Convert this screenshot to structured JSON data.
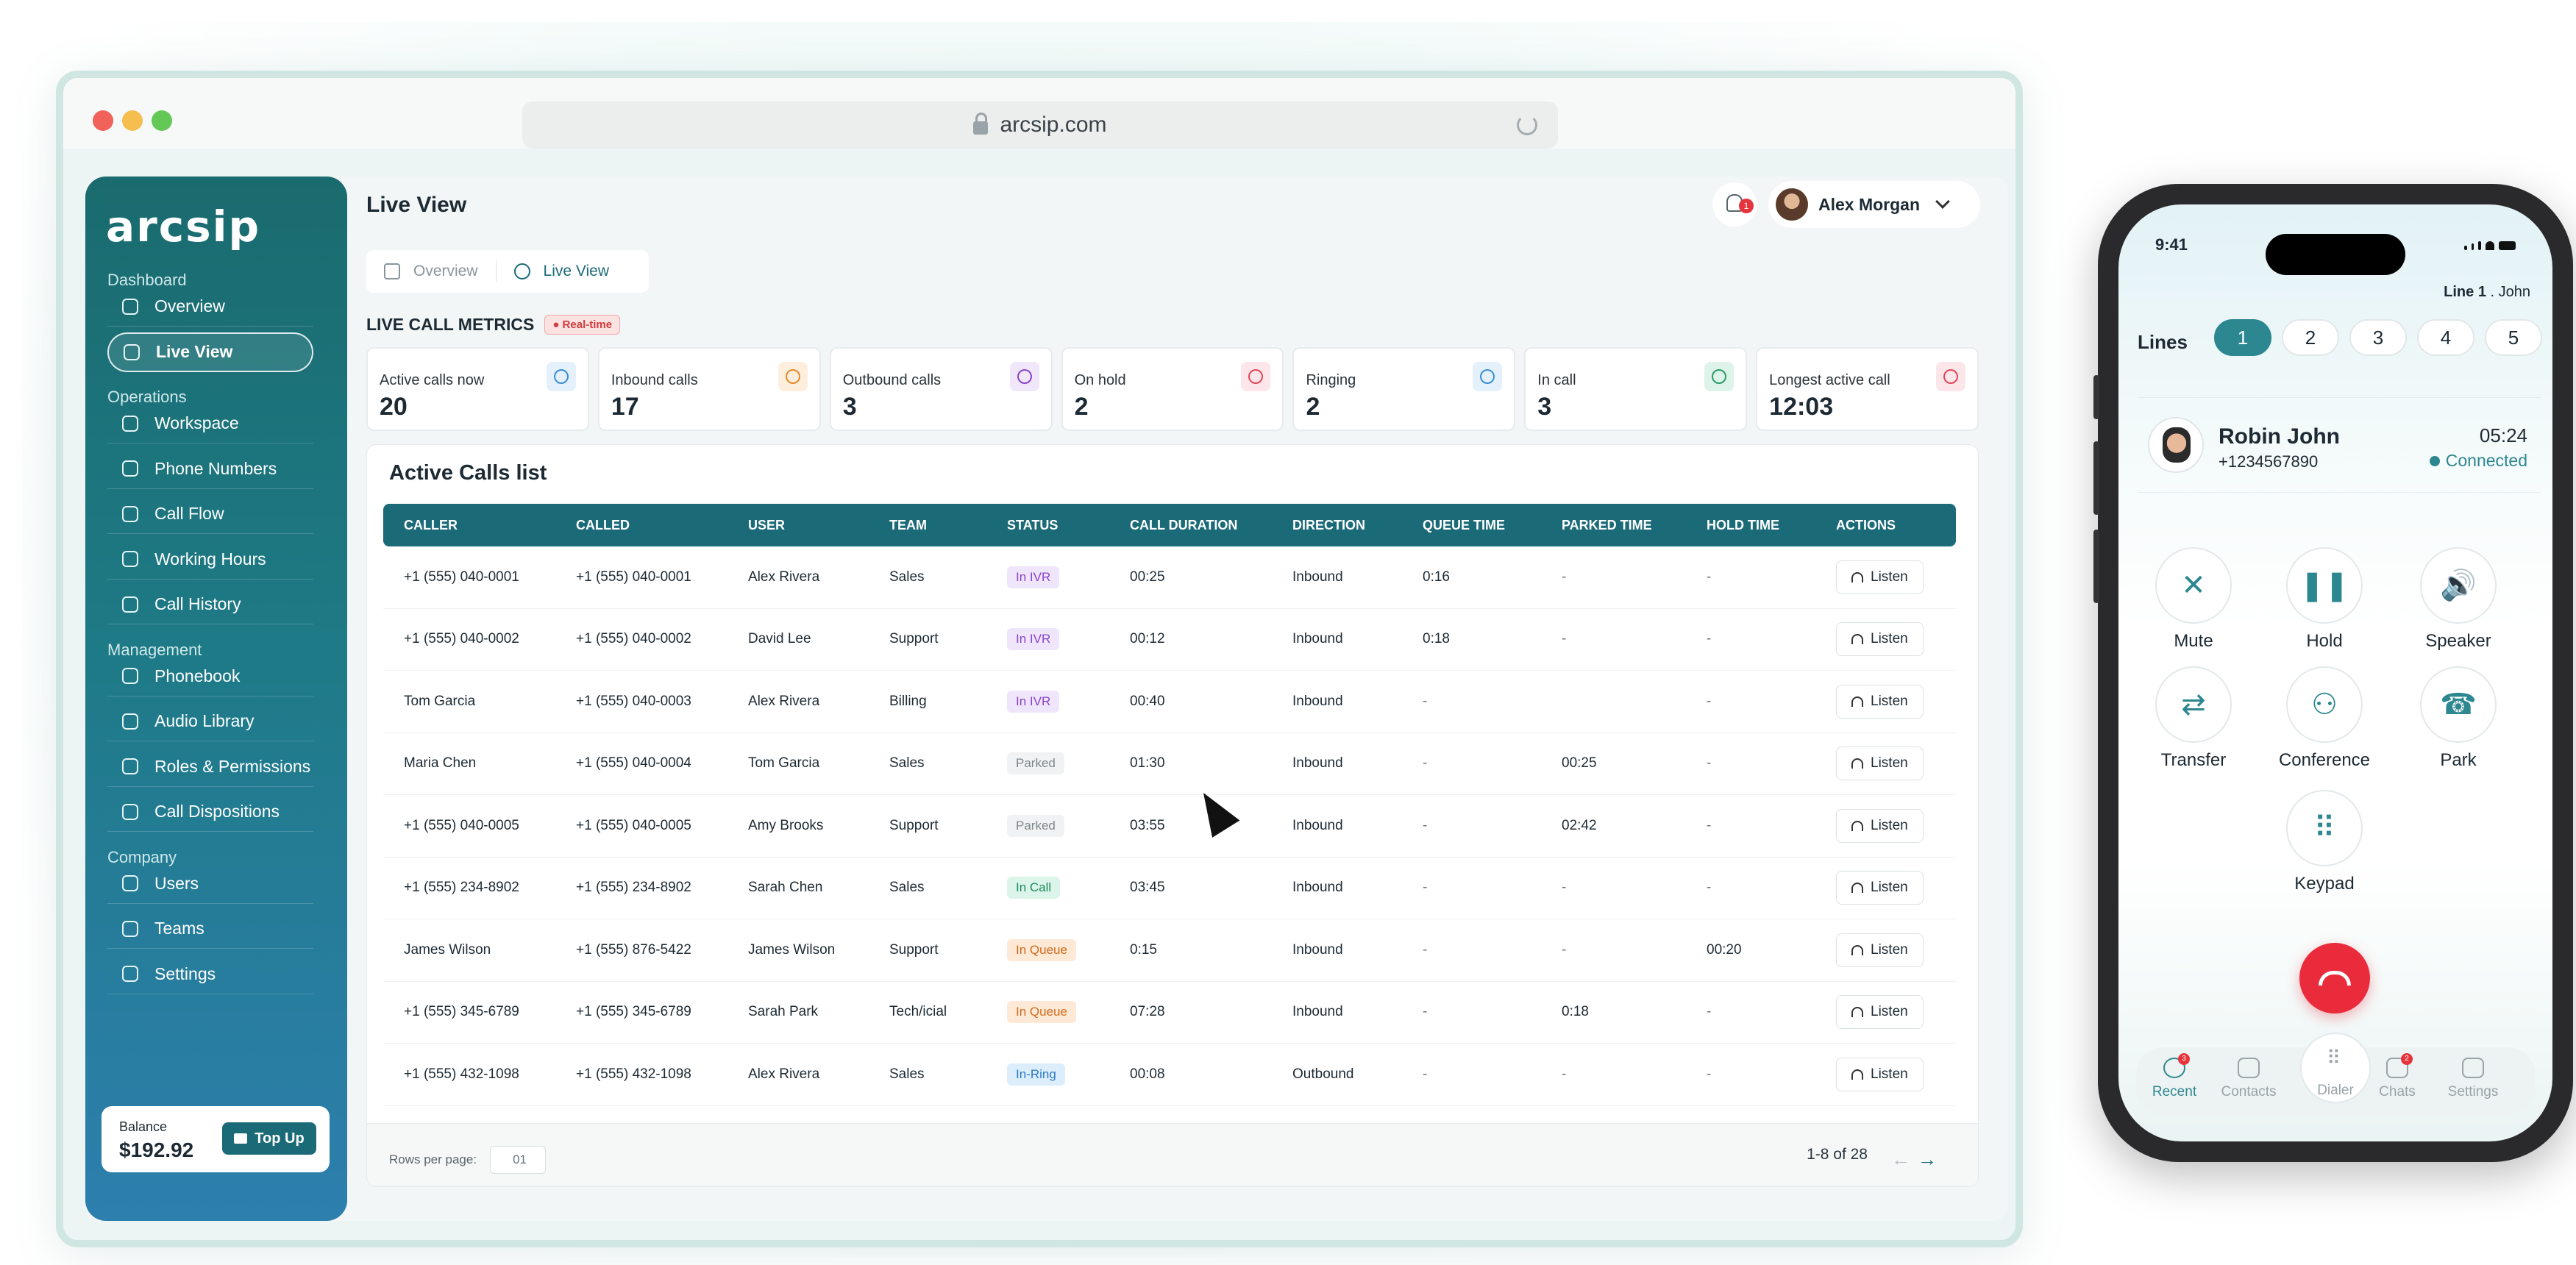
{
  "browser": {
    "url": "arcsip.com"
  },
  "brand": {
    "logo": "arcsip"
  },
  "sidebar": {
    "sections": [
      {
        "title": "Dashboard",
        "items": [
          {
            "label": "Overview",
            "icon": "overview-icon"
          },
          {
            "label": "Live View",
            "icon": "live-view-icon",
            "active": true
          }
        ]
      },
      {
        "title": "Operations",
        "items": [
          {
            "label": "Workspace",
            "icon": "workspace-icon"
          },
          {
            "label": "Phone Numbers",
            "icon": "grid-icon"
          },
          {
            "label": "Call Flow",
            "icon": "flow-icon"
          },
          {
            "label": "Working Hours",
            "icon": "clock-icon"
          },
          {
            "label": "Call History",
            "icon": "history-icon"
          }
        ]
      },
      {
        "title": "Management",
        "items": [
          {
            "label": "Phonebook",
            "icon": "phonebook-icon"
          },
          {
            "label": "Audio Library",
            "icon": "mic-icon"
          },
          {
            "label": "Roles & Permissions",
            "icon": "roles-icon"
          },
          {
            "label": "Call Dispositions",
            "icon": "phone-icon"
          }
        ]
      },
      {
        "title": "Company",
        "items": [
          {
            "label": "Users",
            "icon": "users-icon"
          },
          {
            "label": "Teams",
            "icon": "teams-icon"
          },
          {
            "label": "Settings",
            "icon": "gear-icon"
          }
        ]
      }
    ],
    "balance": {
      "label": "Balance",
      "amount": "$192.92",
      "button": "Top Up"
    }
  },
  "header": {
    "title": "Live View",
    "notifications": "1",
    "user": "Alex Morgan"
  },
  "tabs": [
    {
      "label": "Overview",
      "active": false
    },
    {
      "label": "Live View",
      "active": true
    }
  ],
  "metrics": {
    "title": "LIVE CALL METRICS",
    "badge": "Real-time",
    "cards": [
      {
        "label": "Active calls now",
        "value": "20",
        "color": "#3a8fd8",
        "bg": "#e4f0fb"
      },
      {
        "label": "Inbound calls",
        "value": "17",
        "color": "#e88a2c",
        "bg": "#fdeedd"
      },
      {
        "label": "Outbound calls",
        "value": "3",
        "color": "#8a44c9",
        "bg": "#f0e7fb"
      },
      {
        "label": "On hold",
        "value": "2",
        "color": "#e0485a",
        "bg": "#fce6e9"
      },
      {
        "label": "Ringing",
        "value": "2",
        "color": "#3a8fd8",
        "bg": "#e4f0fb"
      },
      {
        "label": "In call",
        "value": "3",
        "color": "#2a9a6b",
        "bg": "#def4ea"
      },
      {
        "label": "Longest active call",
        "value": "12:03",
        "color": "#e0485a",
        "bg": "#fce6e9"
      }
    ]
  },
  "calls": {
    "title": "Active Calls list",
    "columns": [
      "CALLER",
      "CALLED",
      "USER",
      "TEAM",
      "STATUS",
      "CALL DURATION",
      "DIRECTION",
      "QUEUE TIME",
      "PARKED TIME",
      "HOLD TIME",
      "ACTIONS"
    ],
    "action_label": "Listen",
    "rows": [
      {
        "caller": "+1 (555) 040-0001",
        "called": "+1 (555) 040-0001",
        "user": "Alex Rivera",
        "team": "Sales",
        "status": "In IVR",
        "status_type": "ivr",
        "duration": "00:25",
        "direction": "Inbound",
        "queue": "0:16",
        "parked": "-",
        "hold": "-"
      },
      {
        "caller": "+1 (555) 040-0002",
        "called": "+1 (555) 040-0002",
        "user": "David Lee",
        "team": "Support",
        "status": "In IVR",
        "status_type": "ivr",
        "duration": "00:12",
        "direction": "Inbound",
        "queue": "0:18",
        "parked": "-",
        "hold": "-"
      },
      {
        "caller": "Tom Garcia",
        "called": "+1 (555) 040-0003",
        "user": "Alex Rivera",
        "team": "Billing",
        "status": "In IVR",
        "status_type": "ivr",
        "duration": "00:40",
        "direction": "Inbound",
        "queue": "-",
        "parked": "",
        "hold": "-"
      },
      {
        "caller": "Maria Chen",
        "called": "+1 (555) 040-0004",
        "user": "Tom Garcia",
        "team": "Sales",
        "status": "Parked",
        "status_type": "parked",
        "duration": "01:30",
        "direction": "Inbound",
        "queue": "-",
        "parked": "00:25",
        "hold": "-"
      },
      {
        "caller": "+1 (555) 040-0005",
        "called": "+1 (555) 040-0005",
        "user": "Amy Brooks",
        "team": "Support",
        "status": "Parked",
        "status_type": "parked",
        "duration": "03:55",
        "direction": "Inbound",
        "queue": "-",
        "parked": "02:42",
        "hold": "-"
      },
      {
        "caller": "+1 (555) 234-8902",
        "called": "+1 (555) 234-8902",
        "user": "Sarah Chen",
        "team": "Sales",
        "status": "In Call",
        "status_type": "incall",
        "duration": "03:45",
        "direction": "Inbound",
        "queue": "-",
        "parked": "-",
        "hold": "-"
      },
      {
        "caller": "James Wilson",
        "called": "+1 (555) 876-5422",
        "user": "James Wilson",
        "team": "Support",
        "status": "In Queue",
        "status_type": "queue",
        "duration": "0:15",
        "direction": "Inbound",
        "queue": "-",
        "parked": "-",
        "hold": "00:20"
      },
      {
        "caller": "+1 (555) 345-6789",
        "called": "+1 (555) 345-6789",
        "user": "Sarah Park",
        "team": "Tech/icial",
        "status": "In Queue",
        "status_type": "queue",
        "duration": "07:28",
        "direction": "Inbound",
        "queue": "-",
        "parked": "0:18",
        "hold": "-"
      },
      {
        "caller": "+1 (555) 432-1098",
        "called": "+1 (555) 432-1098",
        "user": "Alex Rivera",
        "team": "Sales",
        "status": "In-Ring",
        "status_type": "ring",
        "duration": "00:08",
        "direction": "Outbound",
        "queue": "-",
        "parked": "-",
        "hold": "-"
      }
    ],
    "rows_per_page_label": "Rows per page:",
    "rows_per_page": "01",
    "page_info": "1-8 of 28"
  },
  "phone": {
    "time": "9:41",
    "line_info": "Line 1",
    "line_user": ". John",
    "lines_label": "Lines",
    "lines": [
      "1",
      "2",
      "3",
      "4",
      "5"
    ],
    "contact": {
      "name": "Robin John",
      "number": "+1234567890",
      "duration": "05:24",
      "status": "Connected"
    },
    "controls": [
      {
        "label": "Mute",
        "icon": "mic-off-icon",
        "glyph": "✕"
      },
      {
        "label": "Hold",
        "icon": "pause-icon",
        "glyph": "❚❚"
      },
      {
        "label": "Speaker",
        "icon": "speaker-icon",
        "glyph": "🔊"
      },
      {
        "label": "Transfer",
        "icon": "transfer-icon",
        "glyph": "⇄"
      },
      {
        "label": "Conference",
        "icon": "conference-icon",
        "glyph": "⚇"
      },
      {
        "label": "Park",
        "icon": "park-icon",
        "glyph": "☎"
      },
      {
        "label": "Keypad",
        "icon": "keypad-icon",
        "glyph": "⠿"
      }
    ],
    "tabbar": [
      {
        "label": "Recent",
        "badge": "3",
        "active": true
      },
      {
        "label": "Contacts"
      },
      {
        "label": "Dialer"
      },
      {
        "label": "Chats",
        "badge": "2"
      },
      {
        "label": "Settings"
      }
    ]
  }
}
